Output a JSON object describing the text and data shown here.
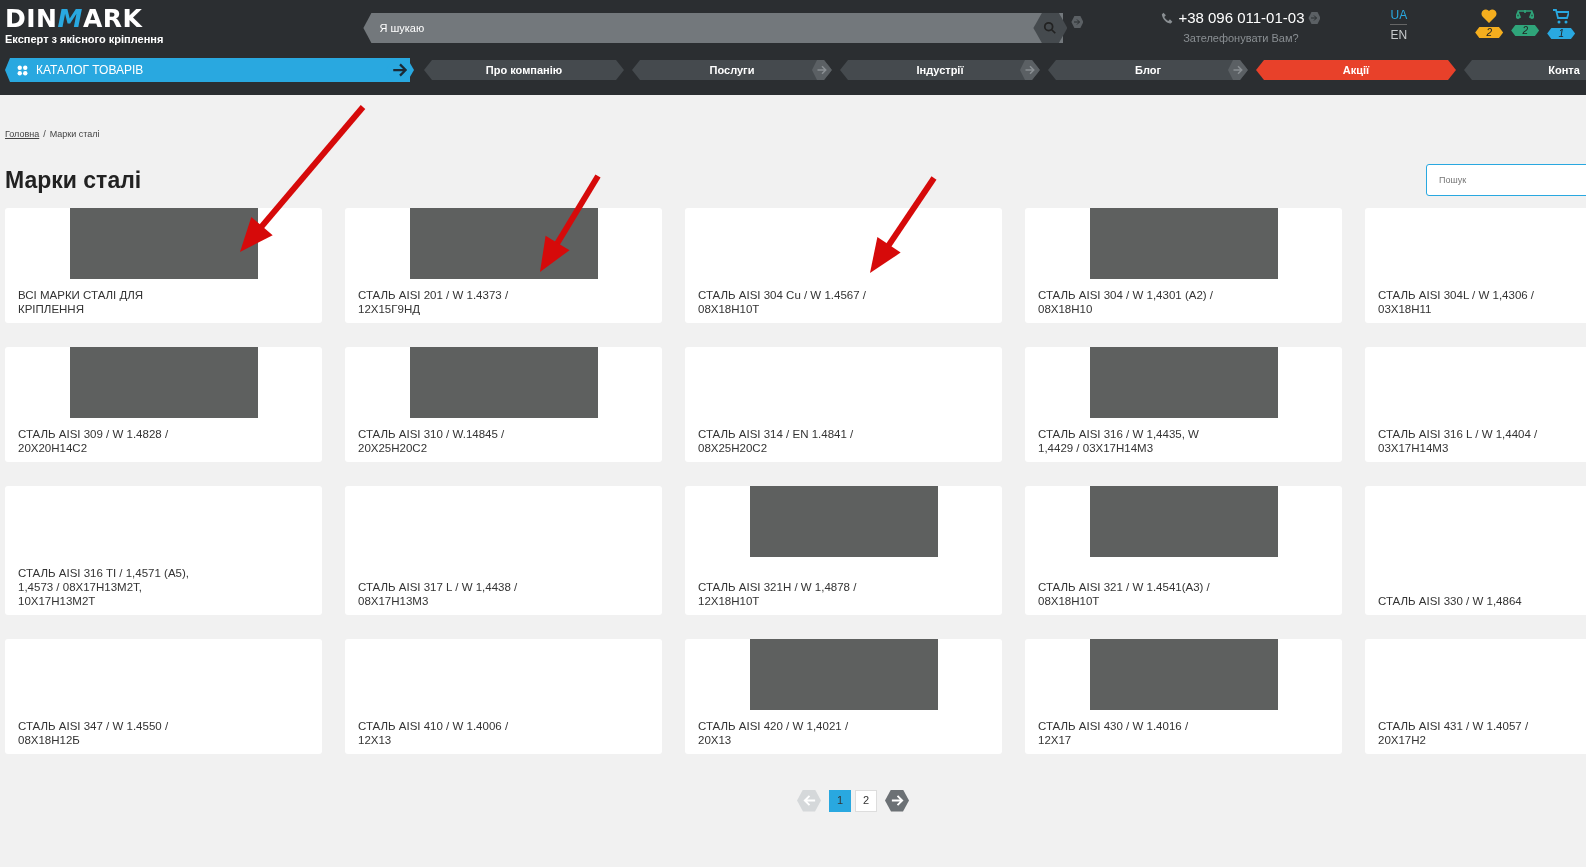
{
  "header": {
    "logo": {
      "before": "DIN",
      "accent": "M",
      "after": "ARK",
      "tagline": "Експерт з якісного кріплення"
    },
    "search": {
      "placeholder": "Я шукаю"
    },
    "phone": {
      "number": "+38 096 011-01-03",
      "callback": "Зателефонувати Вам?"
    },
    "languages": [
      {
        "label": "UA",
        "selected": true
      },
      {
        "label": "EN",
        "selected": false
      }
    ],
    "counters": [
      {
        "kind": "heart",
        "count": "2",
        "color": "#f5ae1e"
      },
      {
        "kind": "scales",
        "count": "2",
        "color": "#2fa57a"
      },
      {
        "kind": "cart",
        "count": "1",
        "color": "#29a8e0"
      }
    ]
  },
  "nav": {
    "catalog": "КАТАЛОГ ТОВАРІВ",
    "items": [
      {
        "label": "Про компанію",
        "arrow": false,
        "color": "#454a4e"
      },
      {
        "label": "Послуги",
        "arrow": true,
        "color": "#454a4e"
      },
      {
        "label": "Індустрії",
        "arrow": true,
        "color": "#454a4e"
      },
      {
        "label": "Блог",
        "arrow": true,
        "color": "#454a4e"
      },
      {
        "label": "Акції",
        "arrow": false,
        "color": "#e8412a"
      },
      {
        "label": "Конта",
        "color": "#454a4e"
      }
    ]
  },
  "breadcrumb": [
    {
      "label": "Головна",
      "link": true
    },
    {
      "label": "Марки сталі",
      "link": false
    }
  ],
  "breadcrumb_separator": "/",
  "title": "Марки сталі",
  "filter": {
    "placeholder": "Пошук"
  },
  "cards": [
    {
      "label": "ВСІ МАРКИ СТАЛІ ДЛЯ КРІПЛЕННЯ",
      "image": true
    },
    {
      "label": "СТАЛЬ AISI 201 / W 1.4373 / 12Х15Г9НД",
      "image": true
    },
    {
      "label": "СТАЛЬ AISI 304 Cu / W 1.4567 / 08Х18Н10Т",
      "image": false
    },
    {
      "label": "СТАЛЬ AISI 304 / W 1,4301 (А2) / 08Х18Н10",
      "image": true
    },
    {
      "label": "СТАЛЬ AISI 304L / W 1,4306 / 03Х18Н11",
      "image": false
    },
    {
      "label": "СТАЛЬ AISI 309 / W 1.4828 / 20Х20Н14С2",
      "image": true
    },
    {
      "label": "СТАЛЬ AISI 310 / W.14845 / 20Х25Н20С2",
      "image": true
    },
    {
      "label": "СТАЛЬ AISI 314 / EN 1.4841 / 08Х25Н20С2",
      "image": false
    },
    {
      "label": "СТАЛЬ AISI 316 / W 1,4435, W 1,4429 / 03Х17Н14М3",
      "image": true
    },
    {
      "label": "СТАЛЬ AISI 316 L / W 1,4404 / 03Х17Н14М3",
      "image": false
    },
    {
      "label": "СТАЛЬ AISI 316 TI / 1,4571 (A5), 1,4573 / 08Х17Н13М2Т, 10Х17Н13М2Т",
      "image": false
    },
    {
      "label": "СТАЛЬ AISI 317 L / W 1,4438 / 08Х17Н13М3",
      "image": false
    },
    {
      "label": "СТАЛЬ AISI 321H / W 1,4878 / 12Х18Н10Т",
      "image": true
    },
    {
      "label": "СТАЛЬ AISI 321 / W 1.4541(А3) / 08Х18Н10Т",
      "image": true
    },
    {
      "label": "СТАЛЬ AISI 330 / W 1,4864",
      "image": false
    },
    {
      "label": "СТАЛЬ AISI 347 / W 1.4550 / 08Х18Н12Б",
      "image": false
    },
    {
      "label": "СТАЛЬ AISI 410 / W 1.4006 / 12Х13",
      "image": false
    },
    {
      "label": "СТАЛЬ AISI 420 / W 1,4021 / 20Х13",
      "image": true
    },
    {
      "label": "СТАЛЬ AISI 430 / W 1.4016 / 12Х17",
      "image": true
    },
    {
      "label": "СТАЛЬ AISI 431 / W 1.4057 / 20Х17Н2",
      "image": false
    }
  ],
  "pagination": {
    "prev_disabled": true,
    "pages": [
      {
        "label": "1",
        "selected": true
      },
      {
        "label": "2",
        "selected": false
      }
    ]
  }
}
